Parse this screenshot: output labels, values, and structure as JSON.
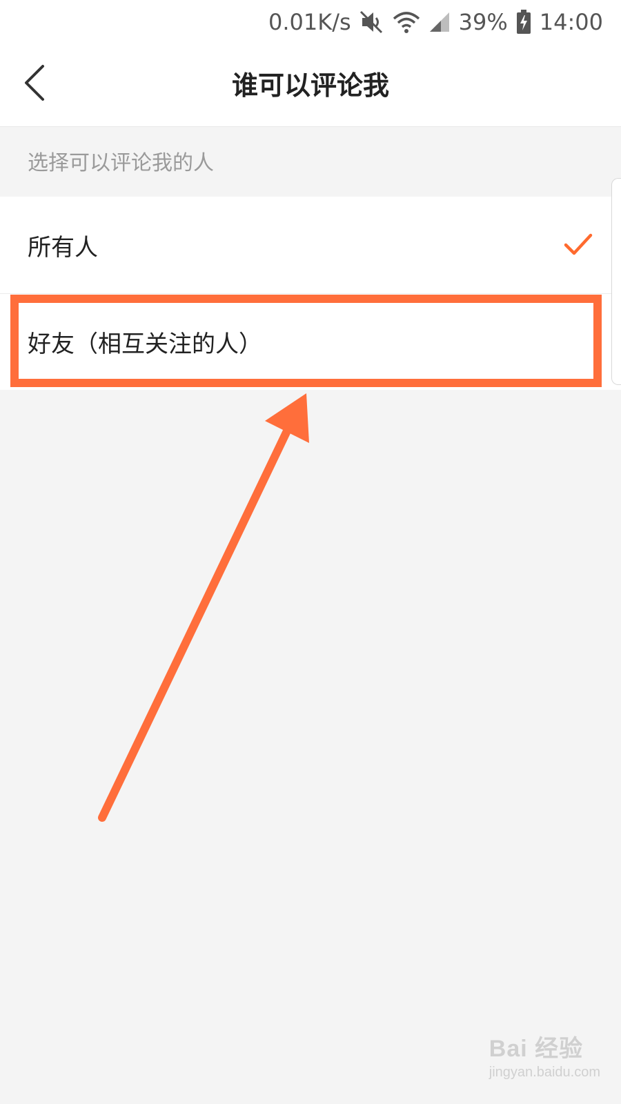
{
  "status_bar": {
    "network_speed": "0.01K/s",
    "battery_percent": "39%",
    "time": "14:00",
    "icons": [
      "mute-icon",
      "wifi-icon",
      "signal-icon",
      "battery-charging-icon"
    ]
  },
  "header": {
    "title": "谁可以评论我",
    "back_icon": "chevron-left-icon"
  },
  "section": {
    "label": "选择可以评论我的人"
  },
  "options": [
    {
      "label": "所有人",
      "selected": true
    },
    {
      "label": "好友（相互关注的人）",
      "selected": false
    }
  ],
  "watermark": {
    "logo_text": "Bai 经验",
    "url": "jingyan.baidu.com"
  },
  "colors": {
    "accent": "#ff6a2e",
    "annotation": "#ff6e3b",
    "background": "#f4f4f4"
  }
}
